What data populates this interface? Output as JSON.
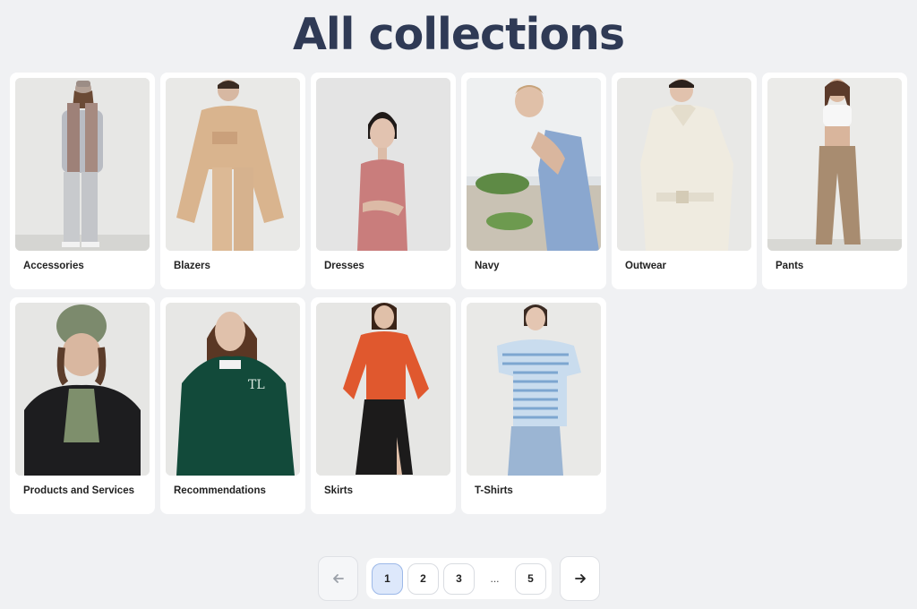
{
  "page": {
    "title": "All collections"
  },
  "collections": [
    {
      "label": "Accessories"
    },
    {
      "label": "Blazers"
    },
    {
      "label": "Dresses"
    },
    {
      "label": "Navy"
    },
    {
      "label": "Outwear"
    },
    {
      "label": "Pants"
    },
    {
      "label": "Products and Services"
    },
    {
      "label": "Recommendations"
    },
    {
      "label": "Skirts"
    },
    {
      "label": "T-Shirts"
    }
  ],
  "pagination": {
    "prev_icon": "arrow-left-icon",
    "next_icon": "arrow-right-icon",
    "pages": [
      "1",
      "2",
      "3",
      "...",
      "5"
    ],
    "current": "1"
  },
  "colors": {
    "background": "#f0f1f3",
    "title": "#2f3a55",
    "active_page": "#dde8fb"
  }
}
